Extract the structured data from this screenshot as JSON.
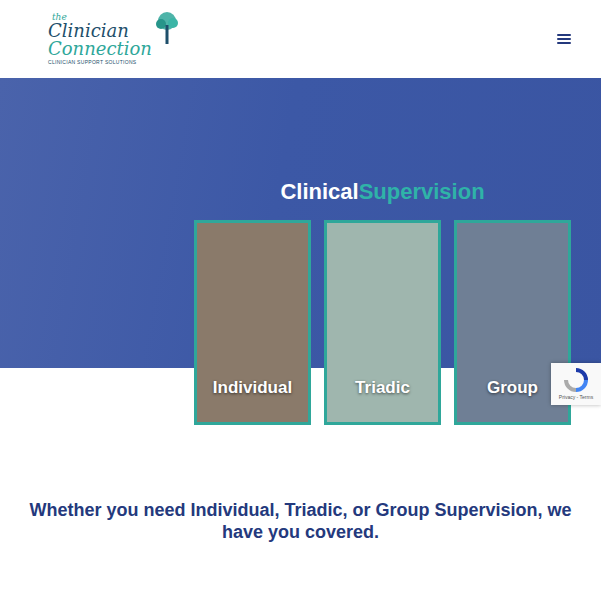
{
  "header": {
    "logo": {
      "small": "the",
      "line1": "Clinician",
      "line2": "Connection",
      "tagline": "CLINICIAN SUPPORT SOLUTIONS"
    }
  },
  "hero": {
    "title_first": "Clinical",
    "title_second": "Supervision"
  },
  "cards": [
    {
      "label": "Individual",
      "color": "#8a7a6a"
    },
    {
      "label": "Triadic",
      "color": "#9fb6ae"
    },
    {
      "label": "Group",
      "color": "#6f7f95"
    }
  ],
  "recaptcha": {
    "text": "Privacy - Terms"
  },
  "intro": {
    "text": "Whether you need Individual, Triadic, or Group Supervision, we have you covered."
  }
}
